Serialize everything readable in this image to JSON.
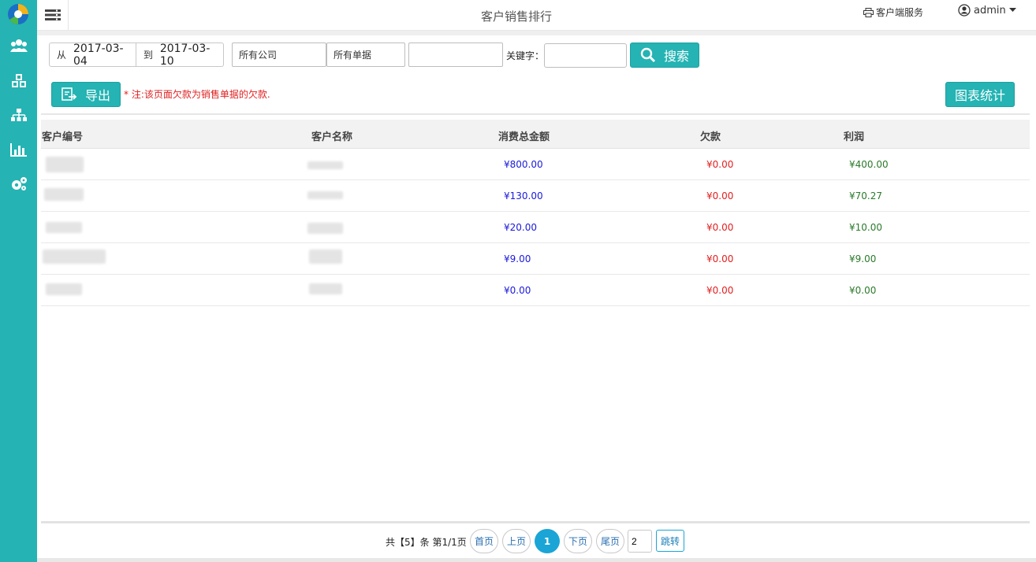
{
  "header": {
    "title": "客户销售排行",
    "client_service": "客户端服务",
    "user": "admin"
  },
  "sidebar": {
    "icons": [
      "users-icon",
      "cubes-icon",
      "sitemap-icon",
      "bar-chart-icon",
      "cogs-icon"
    ]
  },
  "filters": {
    "date_from_label": "从",
    "date_from": "2017-03-04",
    "date_to_label": "到",
    "date_to": "2017-03-10",
    "company_select": "所有公司",
    "document_select": "所有单据",
    "third_select": "",
    "keyword_label": "关键字：",
    "keyword_value": "",
    "search_label": "搜索"
  },
  "actions": {
    "export_label": "导出",
    "note": "* 注:该页面欠款为销售单据的欠款.",
    "chart_label": "图表统计"
  },
  "table": {
    "columns": [
      "客户编号",
      "客户名称",
      "消费总金额",
      "欠款",
      "利润"
    ],
    "rows": [
      {
        "total": "¥800.00",
        "debt": "¥0.00",
        "profit": "¥400.00"
      },
      {
        "total": "¥130.00",
        "debt": "¥0.00",
        "profit": "¥70.27"
      },
      {
        "total": "¥20.00",
        "debt": "¥0.00",
        "profit": "¥10.00"
      },
      {
        "total": "¥9.00",
        "debt": "¥0.00",
        "profit": "¥9.00"
      },
      {
        "total": "¥0.00",
        "debt": "¥0.00",
        "profit": "¥0.00"
      }
    ]
  },
  "pager": {
    "summary": "共【5】条 第1/1页",
    "first": "首页",
    "prev": "上页",
    "current": "1",
    "next": "下页",
    "last": "尾页",
    "jump_value": "2",
    "jump_label": "跳转"
  },
  "colors": {
    "accent": "#25b3b3",
    "amount": "#1a1adb",
    "debt": "#e02020",
    "profit": "#2a7a2a",
    "current_page": "#1aa5d6"
  }
}
